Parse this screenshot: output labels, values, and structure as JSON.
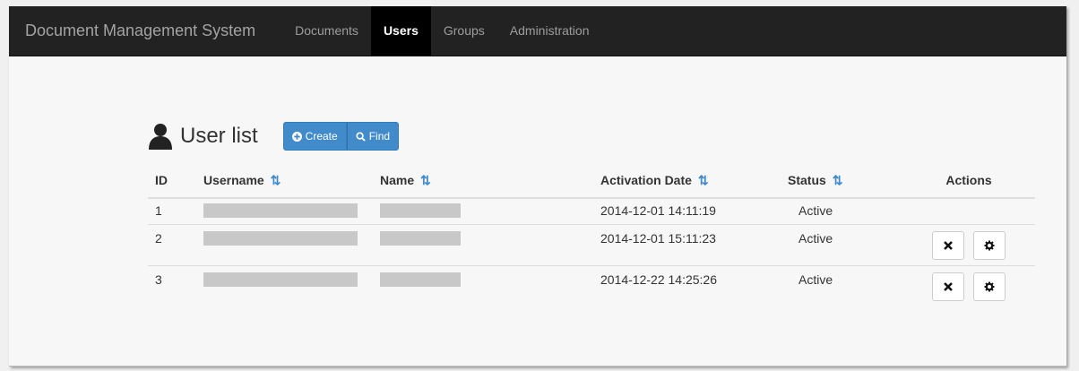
{
  "navbar": {
    "brand": "Document Management System",
    "items": [
      {
        "label": "Documents",
        "active": false
      },
      {
        "label": "Users",
        "active": true
      },
      {
        "label": "Groups",
        "active": false
      },
      {
        "label": "Administration",
        "active": false
      }
    ]
  },
  "page": {
    "title": "User list",
    "buttons": {
      "create": "Create",
      "find": "Find"
    }
  },
  "table": {
    "headers": {
      "id": "ID",
      "username": "Username",
      "name": "Name",
      "activation_date": "Activation Date",
      "status": "Status",
      "actions": "Actions"
    },
    "sort_icon": "⇅",
    "rows": [
      {
        "id": "1",
        "activation_date": "2014-12-01 14:11:19",
        "status": "Active"
      },
      {
        "id": "2",
        "activation_date": "2014-12-01 15:11:23",
        "status": "Active"
      },
      {
        "id": "3",
        "activation_date": "2014-12-22 14:25:26",
        "status": "Active"
      }
    ]
  },
  "colors": {
    "navbar_bg": "#222222",
    "primary": "#428bca",
    "redaction": "#c8c8c8"
  }
}
